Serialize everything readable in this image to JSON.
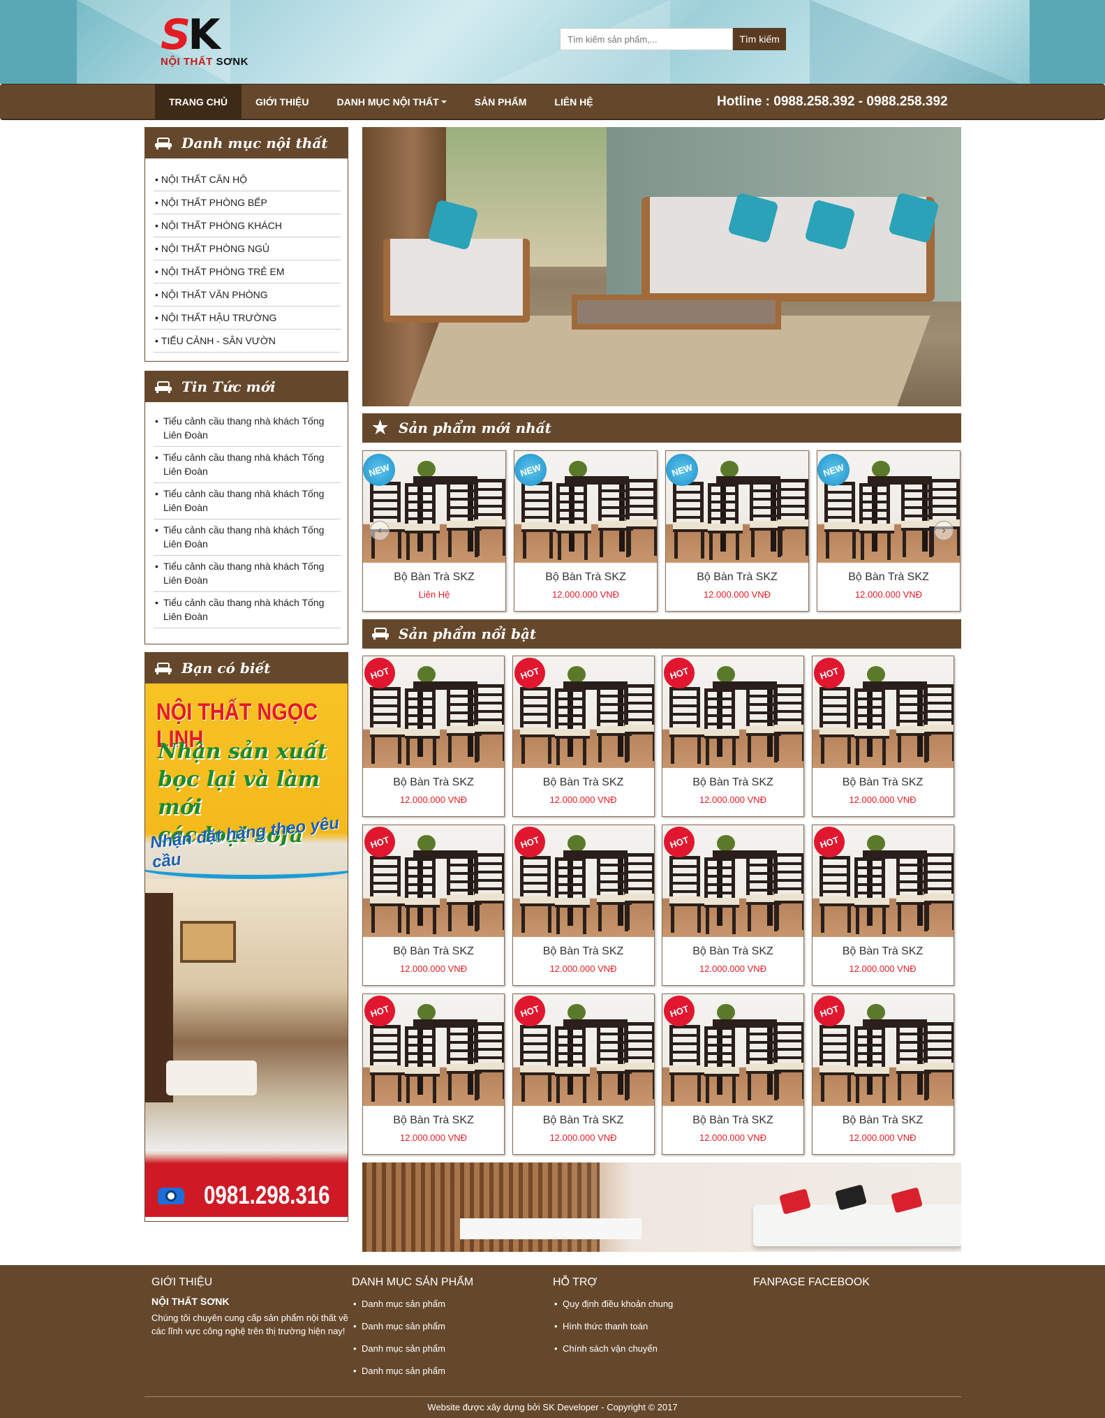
{
  "header": {
    "logo_letters": "SK",
    "logo_tag_prefix": "NỘI THẤT ",
    "logo_tag_brand": "SƠNK",
    "search_placeholder": "Tìm kiếm sản phẩm,...",
    "search_button": "Tìm kiếm"
  },
  "nav": {
    "items": [
      "TRANG CHỦ",
      "GIỚI THIỆU",
      "DANH MỤC NỘI THẤT",
      "SẢN PHẨM",
      "LIÊN HỆ"
    ],
    "hotline": "Hotline : 0988.258.392 - 0988.258.392"
  },
  "sidebar": {
    "categories_title": "Danh mục nội thất",
    "categories": [
      "NỘI THẤT CĂN HỘ",
      "NỘI THẤT PHÒNG BẾP",
      "NỘI THẤT PHÒNG KHÁCH",
      "NỘI THẤT PHÒNG NGỦ",
      "NỘI THẤT PHÒNG TRẺ EM",
      "NỘI THẤT VĂN PHÒNG",
      "NỘI THẤT HẬU TRƯỜNG",
      "TIỂU CẢNH - SÂN VƯỜN"
    ],
    "news_title": "Tin Tức mới",
    "news": [
      "Tiểu cảnh cầu thang nhà khách Tống Liên Đoàn",
      "Tiểu cảnh cầu thang nhà khách Tống Liên Đoàn",
      "Tiểu cảnh cầu thang nhà khách Tống Liên Đoàn",
      "Tiểu cảnh cầu thang nhà khách Tống Liên Đoàn",
      "Tiểu cảnh cầu thang nhà khách Tống Liên Đoàn",
      "Tiểu cảnh cầu thang nhà khách Tống Liên Đoàn"
    ],
    "did_you_know_title": "Bạn có biết",
    "banner": {
      "headline": "NỘI THẤT NGỌC LINH",
      "line1": "Nhận sản xuất",
      "line2": "bọc lại và làm mới",
      "line3": "các loại sofa",
      "line4": "Nhận đặt hàng theo yêu cầu",
      "phone": "0981.298.316"
    }
  },
  "main": {
    "new_products_title": "Sản phẩm mới nhất",
    "new_badge": "NEW",
    "new_products": [
      {
        "name": "Bộ Bàn Trà SKZ",
        "price": "Liên Hệ"
      },
      {
        "name": "Bộ Bàn Trà SKZ",
        "price": "12.000.000 VNĐ"
      },
      {
        "name": "Bộ Bàn Trà SKZ",
        "price": "12.000.000 VNĐ"
      },
      {
        "name": "Bộ Bàn Trà SKZ",
        "price": "12.000.000 VNĐ"
      }
    ],
    "featured_title": "Sản phẩm nổi bật",
    "hot_badge": "HOT",
    "featured_products": [
      {
        "name": "Bộ Bàn Trà SKZ",
        "price": "12.000.000 VNĐ"
      },
      {
        "name": "Bộ Bàn Trà SKZ",
        "price": "12.000.000 VNĐ"
      },
      {
        "name": "Bộ Bàn Trà SKZ",
        "price": "12.000.000 VNĐ"
      },
      {
        "name": "Bộ Bàn Trà SKZ",
        "price": "12.000.000 VNĐ"
      },
      {
        "name": "Bộ Bàn Trà SKZ",
        "price": "12.000.000 VNĐ"
      },
      {
        "name": "Bộ Bàn Trà SKZ",
        "price": "12.000.000 VNĐ"
      },
      {
        "name": "Bộ Bàn Trà SKZ",
        "price": "12.000.000 VNĐ"
      },
      {
        "name": "Bộ Bàn Trà SKZ",
        "price": "12.000.000 VNĐ"
      },
      {
        "name": "Bộ Bàn Trà SKZ",
        "price": "12.000.000 VNĐ"
      },
      {
        "name": "Bộ Bàn Trà SKZ",
        "price": "12.000.000 VNĐ"
      },
      {
        "name": "Bộ Bàn Trà SKZ",
        "price": "12.000.000 VNĐ"
      },
      {
        "name": "Bộ Bàn Trà SKZ",
        "price": "12.000.000 VNĐ"
      }
    ]
  },
  "footer": {
    "about_title": "GIỚI THIỆU",
    "about_brand": "NỘI THẤT SƠNK",
    "about_text": "Chúng tôi chuyên cung cấp sản phẩm nội thất về các lĩnh vực công nghệ trên thị trường hiện nay!",
    "categories_title": "DANH MỤC SẢN PHẨM",
    "categories": [
      "Danh mục sản phẩm",
      "Danh mục sản phẩm",
      "Danh mục sản phẩm",
      "Danh mục sản phẩm"
    ],
    "support_title": "HỖ TRỢ",
    "support": [
      "Quy định điều khoản chung",
      "Hình thức thanh toán",
      "Chính sách vận chuyển"
    ],
    "fanpage_title": "FANPAGE FACEBOOK",
    "copyright": "Website được xây dựng bởi SK Developer - Copyright © 2017"
  },
  "colors": {
    "brand_brown": "#65482c",
    "dark_brown": "#3d2a17",
    "price_red": "#e31b23",
    "logo_red": "#e31b23"
  },
  "icons": {
    "section_icon": "sofa-icon",
    "new_section_icon": "star-icon"
  }
}
